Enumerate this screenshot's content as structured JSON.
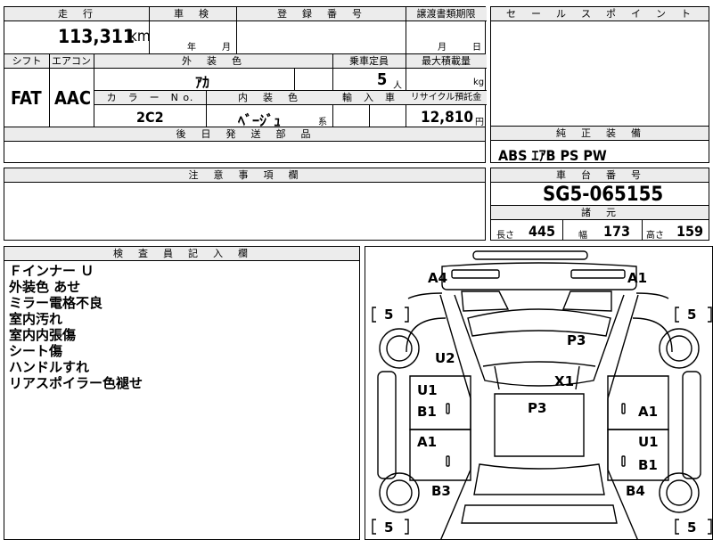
{
  "main_sheet": {
    "headers": {
      "mileage": "走　行",
      "inspection": "車　検",
      "registration": "登　録　番　号",
      "transfer_deadline": "譲渡書類期限",
      "shift": "シフト",
      "aircon": "エアコン",
      "exterior_color": "外　装　色",
      "capacity": "乗車定員",
      "max_load": "最大積載量",
      "color_no": "カ　ラ　ー　N o.",
      "interior_color": "内　装　色",
      "import": "輸　入　車",
      "recycle": "リサイクル預託金",
      "later_parts": "後　日　発　送　部　品"
    },
    "mileage": "113,311",
    "mileage_unit": "km",
    "year_label": "年",
    "month_label": "月",
    "deadline_month": "月",
    "deadline_day": "日",
    "shift": "FAT",
    "aircon": "AAC",
    "exterior_color": "ｱｶ",
    "capacity": "5",
    "capacity_unit": "人",
    "load_unit": "kg",
    "color_no": "2C2",
    "interior_color": "ﾍﾞｰｼﾞｭ",
    "interior_suffix": "系",
    "recycle_fee": "12,810",
    "recycle_unit": "円"
  },
  "sales_point": {
    "header": "セ　ー　ル　ス　ポ　イ　ン　ト"
  },
  "standard_equipment": {
    "header": "純　正　装　備",
    "value": "ABS ｴｱB PS PW"
  },
  "notes_field": {
    "header": "注　意　事　項　欄"
  },
  "chassis": {
    "header": "車　台　番　号",
    "number": "SG5-065155",
    "spec_header": "諸　元",
    "length_label": "長さ",
    "length": "445",
    "width_label": "幅",
    "width": "173",
    "height_label": "高さ",
    "height": "159"
  },
  "inspector": {
    "header": "検　査　員　記　入　欄",
    "notes": [
      "Ｆインナー Ｕ",
      "外装色 あせ",
      "ミラー電格不良",
      "室内汚れ",
      "室内内張傷",
      "シート傷",
      "ハンドルすれ",
      "リアスポイラー色褪せ"
    ]
  },
  "diagram": {
    "tire_front_left": "5",
    "tire_front_right": "5",
    "tire_rear_left": "5",
    "tire_rear_right": "5",
    "a4": "A4",
    "a1_top": "A1",
    "u2": "U2",
    "p3_hood": "P3",
    "x1": "X1",
    "u1_left": "U1",
    "b1_left": "B1",
    "p3_roof": "P3",
    "a1_right_front": "A1",
    "a1_left_rear": "A1",
    "u1_right": "U1",
    "b1_right": "B1",
    "b3": "B3",
    "b4": "B4"
  }
}
